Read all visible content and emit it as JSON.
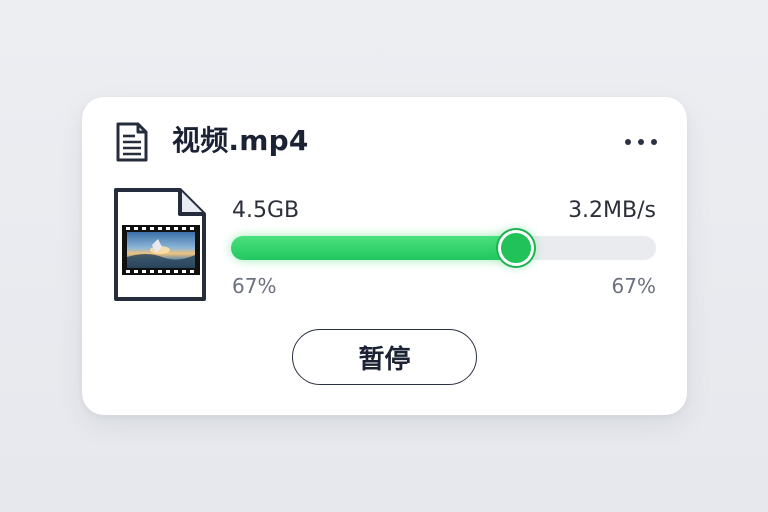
{
  "file": {
    "name": "视频.mp4",
    "header_icon": "document-icon",
    "thumbnail_icon": "video-file-icon"
  },
  "menu": {
    "icon": "more-horizontal-icon"
  },
  "download": {
    "size": "4.5GB",
    "speed": "3.2MB/s",
    "progress": 0.67,
    "progress_label_left": "67%",
    "progress_label_right": "67%"
  },
  "actions": {
    "pause_label": "暂停"
  },
  "colors": {
    "accent": "#22c760",
    "text_primary": "#1b2233",
    "text_secondary": "#6c7180",
    "track": "#e9ebee",
    "card": "#ffffff",
    "background": "#eceef2"
  }
}
